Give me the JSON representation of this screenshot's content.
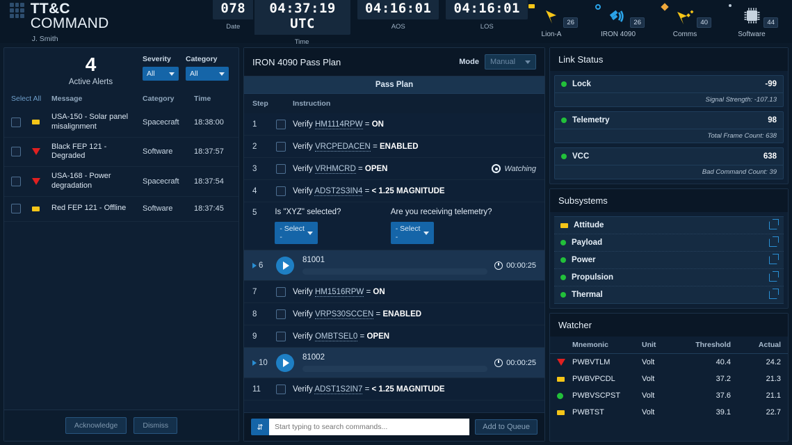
{
  "header": {
    "brand_bold": "TT&C",
    "brand_light": "COMMAND",
    "user": "J. Smith",
    "clocks": [
      {
        "value": "078",
        "label": "Date",
        "name": "date"
      },
      {
        "value": "04:37:19 UTC",
        "label": "Time",
        "name": "time"
      },
      {
        "value": "04:16:01",
        "label": "AOS",
        "name": "aos"
      },
      {
        "value": "04:16:01",
        "label": "LOS",
        "name": "los"
      }
    ],
    "satellites": [
      {
        "label": "Lion-A",
        "badge": "26",
        "icon": "satellite-dish-icon",
        "status": "warning",
        "status_shape": "square",
        "color": "#f5c518"
      },
      {
        "label": "IRON 4090",
        "badge": "26",
        "icon": "satellite-signal-icon",
        "status": "nominal",
        "status_shape": "ring",
        "color": "#2aa3e8"
      },
      {
        "label": "Comms",
        "badge": "40",
        "icon": "comms-antenna-icon",
        "status": "caution",
        "status_shape": "diamond",
        "color": "#f0a93b"
      },
      {
        "label": "Software",
        "badge": "44",
        "icon": "chip-icon",
        "status": "idle",
        "status_shape": "dot",
        "color": "#b9c8d6"
      }
    ]
  },
  "alerts": {
    "count": "4",
    "count_label": "Active Alerts",
    "filters": [
      {
        "label": "Severity",
        "value": "All"
      },
      {
        "label": "Category",
        "value": "All"
      }
    ],
    "select_all": "Select All",
    "columns": {
      "message": "Message",
      "category": "Category",
      "time": "Time"
    },
    "rows": [
      {
        "severity": "caution",
        "message": "USA-150 - Solar panel misalignment",
        "category": "Spacecraft",
        "time": "18:38:00",
        "checked": false
      },
      {
        "severity": "critical",
        "message": "Black FEP 121 - Degraded",
        "category": "Software",
        "time": "18:37:57",
        "checked": false
      },
      {
        "severity": "critical",
        "message": "USA-168 - Power degradation",
        "category": "Spacecraft",
        "time": "18:37:54",
        "checked": false
      },
      {
        "severity": "caution",
        "message": "Red FEP 121 - Offline",
        "category": "Software",
        "time": "18:37:45",
        "checked": false
      }
    ],
    "acknowledge": "Acknowledge",
    "dismiss": "Dismiss"
  },
  "passplan": {
    "title": "IRON 4090 Pass Plan",
    "mode_label": "Mode",
    "mode_value": "Manual",
    "banner": "Pass Plan",
    "col_step": "Step",
    "col_instruction": "Instruction",
    "steps": [
      {
        "type": "verify",
        "n": "1",
        "prefix": "Verify",
        "mnemonic": "HM1114RPW",
        "op": "=",
        "value": "ON",
        "checked": false
      },
      {
        "type": "verify",
        "n": "2",
        "prefix": "Verify",
        "mnemonic": "VRCPEDACEN",
        "op": "=",
        "value": "ENABLED",
        "checked": false
      },
      {
        "type": "verify",
        "n": "3",
        "prefix": "Verify",
        "mnemonic": "VRHMCRD",
        "op": "=",
        "value": "OPEN",
        "checked": false,
        "watching": "Watching"
      },
      {
        "type": "verify",
        "n": "4",
        "prefix": "Verify",
        "mnemonic": "ADST2S3IN4",
        "op": "=",
        "value": "< 1.25 MAGNITUDE",
        "checked": false
      },
      {
        "type": "question",
        "n": "5",
        "q1": "Is \"XYZ\" selected?",
        "q1_value": "- Select -",
        "q2": "Are you receiving telemetry?",
        "q2_value": "- Select -"
      },
      {
        "type": "command",
        "n": "6",
        "cmd_id": "81001",
        "duration": "00:00:25"
      },
      {
        "type": "verify",
        "n": "7",
        "prefix": "Verify",
        "mnemonic": "HM1516RPW",
        "op": "=",
        "value": "ON",
        "checked": false
      },
      {
        "type": "verify",
        "n": "8",
        "prefix": "Verify",
        "mnemonic": "VRPS30SCCEN",
        "op": "=",
        "value": "ENABLED",
        "checked": false
      },
      {
        "type": "verify",
        "n": "9",
        "prefix": "Verify",
        "mnemonic": "OMBTSEL0",
        "op": "=",
        "value": "OPEN",
        "checked": false
      },
      {
        "type": "command",
        "n": "10",
        "cmd_id": "81002",
        "duration": "00:00:25"
      },
      {
        "type": "verify",
        "n": "11",
        "prefix": "Verify",
        "mnemonic": "ADST1S2IN7",
        "op": "=",
        "value": "< 1.25 MAGNITUDE",
        "checked": false
      }
    ],
    "search_placeholder": "Start typing to search commands...",
    "search_value": "",
    "add_to_queue": "Add to Queue"
  },
  "link_status": {
    "title": "Link Status",
    "items": [
      {
        "name": "Lock",
        "value": "-99",
        "status": "green",
        "sub_label": "Signal Strength:",
        "sub_value": "-107.13"
      },
      {
        "name": "Telemetry",
        "value": "98",
        "status": "green",
        "sub_label": "Total Frame Count:",
        "sub_value": "638"
      },
      {
        "name": "VCC",
        "value": "638",
        "status": "green",
        "sub_label": "Bad Command Count:",
        "sub_value": "39"
      }
    ]
  },
  "subsystems": {
    "title": "Subsystems",
    "items": [
      {
        "name": "Attitude",
        "status": "caution"
      },
      {
        "name": "Payload",
        "status": "nominal"
      },
      {
        "name": "Power",
        "status": "nominal"
      },
      {
        "name": "Propulsion",
        "status": "nominal"
      },
      {
        "name": "Thermal",
        "status": "nominal"
      }
    ]
  },
  "watcher": {
    "title": "Watcher",
    "columns": {
      "mnemonic": "Mnemonic",
      "unit": "Unit",
      "threshold": "Threshold",
      "actual": "Actual"
    },
    "rows": [
      {
        "severity": "critical",
        "mnemonic": "PWBVTLM",
        "unit": "Volt",
        "threshold": "40.4",
        "actual": "24.2"
      },
      {
        "severity": "caution",
        "mnemonic": "PWBVPCDL",
        "unit": "Volt",
        "threshold": "37.2",
        "actual": "21.3"
      },
      {
        "severity": "nominal",
        "mnemonic": "PWBVSCPST",
        "unit": "Volt",
        "threshold": "37.6",
        "actual": "21.1"
      },
      {
        "severity": "caution",
        "mnemonic": "PWBTST",
        "unit": "Volt",
        "threshold": "39.1",
        "actual": "22.7"
      }
    ]
  },
  "colors": {
    "critical": "#e02020",
    "caution": "#f5c518",
    "nominal": "#22c03a",
    "accent": "#1565a8",
    "panel": "#0e1f33"
  }
}
